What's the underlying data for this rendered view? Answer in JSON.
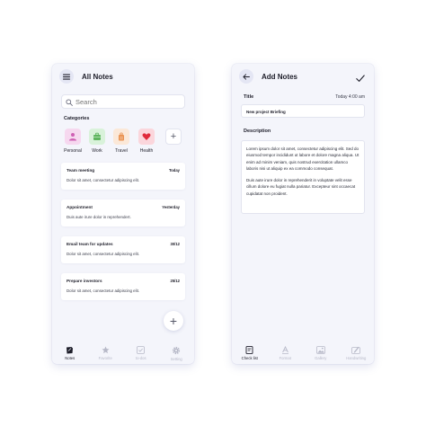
{
  "notes_screen": {
    "title": "All Notes",
    "search_placeholder": "Search",
    "categories_label": "Categories",
    "categories": [
      {
        "label": "Personal",
        "color": "#f6d8ef"
      },
      {
        "label": "Work",
        "color": "#d9f2da"
      },
      {
        "label": "Travel",
        "color": "#fbe8d8"
      },
      {
        "label": "Health",
        "color": "#fbd6dc"
      }
    ],
    "notes": [
      {
        "title": "Team meeting",
        "date": "Today",
        "body": "Dolor sit amet, consectetur adipiscing elit."
      },
      {
        "title": "Appointment",
        "date": "Yesterday",
        "body": "Duis aute irure dolor in reprehendert."
      },
      {
        "title": "Email team for updates",
        "date": "30/12",
        "body": "Dolor sit amet, consectetur adipiscing elit."
      },
      {
        "title": "Prepare investors",
        "date": "25/12",
        "body": "Dolor sit amet, consectetur adipiscing elit."
      }
    ],
    "tabs": [
      "Notes",
      "Favorite",
      "to-dos",
      "Setting"
    ]
  },
  "add_screen": {
    "title": "Add Notes",
    "title_label": "Title",
    "time": "Today 4:00 am",
    "title_value": "New project Briefing",
    "description_label": "Description",
    "description_p1": "Lorem ipsum dolor sit amet, consectetur adipiscing elit. Sed do eiusmod tempor incididunt ut labore et dolore magna aliqua. Ut enim ad minim veniam, quis nostrud exercitation ullamco laboris nisi ut aliquip ex ea commodo consequat.",
    "description_p2": "Duis aute irure dolor in reprehenderit in voluptate velit esse cillum dolore eu fugiat nulla pariatur. Excepteur sint occaecat cupidatat non proident.",
    "tabs": [
      "Check list",
      "Format",
      "Gallery",
      "Handwriting"
    ]
  },
  "colors": {
    "accent": "#1e1e2a",
    "inactive": "#b7b9c8",
    "screen_bg": "#f4f5fb"
  }
}
